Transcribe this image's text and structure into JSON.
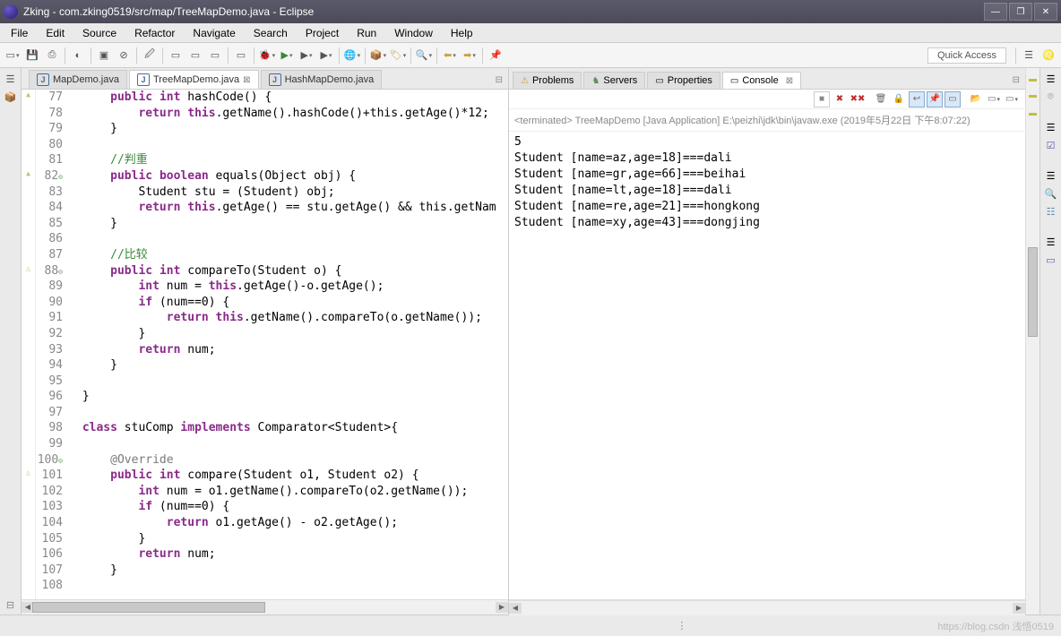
{
  "window": {
    "title": "Zking - com.zking0519/src/map/TreeMapDemo.java - Eclipse"
  },
  "menu": [
    "File",
    "Edit",
    "Source",
    "Refactor",
    "Navigate",
    "Search",
    "Project",
    "Run",
    "Window",
    "Help"
  ],
  "quick_access": "Quick Access",
  "editor_tabs": [
    {
      "label": "MapDemo.java",
      "active": false
    },
    {
      "label": "TreeMapDemo.java",
      "active": true
    },
    {
      "label": "HashMapDemo.java",
      "active": false
    }
  ],
  "right_tabs": [
    {
      "label": "Problems",
      "icon": "⚠",
      "active": false
    },
    {
      "label": "Servers",
      "icon": "♞",
      "active": false
    },
    {
      "label": "Properties",
      "icon": "▭",
      "active": false
    },
    {
      "label": "Console",
      "icon": "▭",
      "active": true
    }
  ],
  "console_header": "<terminated> TreeMapDemo [Java Application] E:\\peizhi\\jdk\\bin\\javaw.exe (2019年5月22日 下午8:07:22)",
  "console_output": [
    "5",
    "Student [name=az,age=18]===dali",
    "Student [name=gr,age=66]===beihai",
    "Student [name=lt,age=18]===dali",
    "Student [name=re,age=21]===hongkong",
    "Student [name=xy,age=43]===dongjing"
  ],
  "line_numbers": [
    "77",
    "78",
    "79",
    "80",
    "81",
    "82",
    "83",
    "84",
    "85",
    "86",
    "87",
    "88",
    "89",
    "90",
    "91",
    "92",
    "93",
    "94",
    "95",
    "96",
    "97",
    "98",
    "99",
    "100",
    "101",
    "102",
    "103",
    "104",
    "105",
    "106",
    "107",
    "108"
  ],
  "line_overrides": {
    "82": "⊝",
    "88": "⊝",
    "100": "⊝",
    "101": ""
  },
  "markers": {
    "77": "tri",
    "82": "tri",
    "88": "tri2",
    "101": "tri2"
  },
  "code": [
    {
      "t": "     public int hashCode() {",
      "k": [
        "public",
        "int"
      ]
    },
    {
      "t": "         return this.getName().hashCode()+this.getAge()*12;",
      "k": [
        "return",
        "this",
        "this"
      ]
    },
    {
      "t": "     }"
    },
    {
      "t": ""
    },
    {
      "t": "     //判重",
      "c": true
    },
    {
      "t": "     public boolean equals(Object obj) {",
      "k": [
        "public",
        "boolean"
      ]
    },
    {
      "t": "         Student stu = (Student) obj;"
    },
    {
      "t": "         return this.getAge() == stu.getAge() && this.getNam",
      "k": [
        "return",
        "this",
        "this"
      ]
    },
    {
      "t": "     }"
    },
    {
      "t": ""
    },
    {
      "t": "     //比较",
      "c": true
    },
    {
      "t": "     public int compareTo(Student o) {",
      "k": [
        "public",
        "int"
      ]
    },
    {
      "t": "         int num = this.getAge()-o.getAge();",
      "k": [
        "int",
        "this"
      ]
    },
    {
      "t": "         if (num==0) {",
      "k": [
        "if"
      ]
    },
    {
      "t": "             return this.getName().compareTo(o.getName());",
      "k": [
        "return",
        "this"
      ]
    },
    {
      "t": "         }"
    },
    {
      "t": "         return num;",
      "k": [
        "return"
      ]
    },
    {
      "t": "     }"
    },
    {
      "t": ""
    },
    {
      "t": " }"
    },
    {
      "t": ""
    },
    {
      "t": " class stuComp implements Comparator<Student>{",
      "k": [
        "class",
        "implements"
      ]
    },
    {
      "t": ""
    },
    {
      "t": "     @Override",
      "a": true
    },
    {
      "t": "     public int compare(Student o1, Student o2) {",
      "k": [
        "public",
        "int"
      ]
    },
    {
      "t": "         int num = o1.getName().compareTo(o2.getName());",
      "k": [
        "int"
      ]
    },
    {
      "t": "         if (num==0) {",
      "k": [
        "if"
      ]
    },
    {
      "t": "             return o1.getAge() - o2.getAge();",
      "k": [
        "return"
      ]
    },
    {
      "t": "         }"
    },
    {
      "t": "         return num;",
      "k": [
        "return"
      ]
    },
    {
      "t": "     }"
    },
    {
      "t": ""
    }
  ],
  "watermark": "https://blog.csdn  浅悟0519"
}
